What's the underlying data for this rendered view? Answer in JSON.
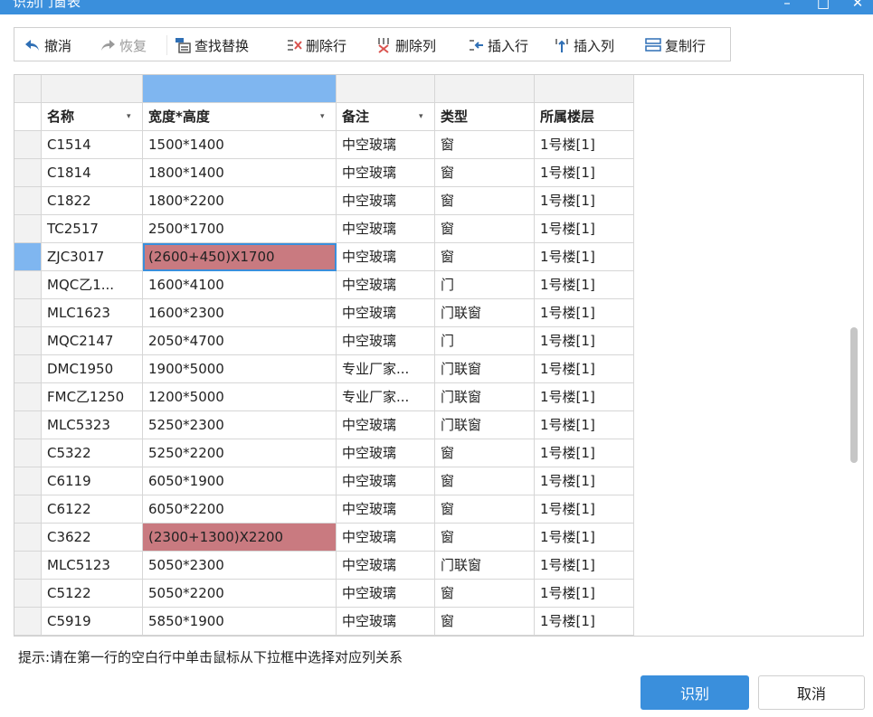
{
  "window": {
    "title": "识别门窗表",
    "min_glyph": "–",
    "max_glyph": "□",
    "close_glyph": "✕"
  },
  "toolbar": {
    "undo": "撤消",
    "redo": "恢复",
    "find_replace": "查找替换",
    "delete_row": "删除行",
    "delete_col": "删除列",
    "insert_row": "插入行",
    "insert_col": "插入列",
    "copy_row": "复制行"
  },
  "table": {
    "headers": [
      "名称",
      "宽度*高度",
      "备注",
      "类型",
      "所属楼层"
    ],
    "rows": [
      [
        "C1514",
        "1500*1400",
        "中空玻璃",
        "窗",
        "1号楼[1]"
      ],
      [
        "C1814",
        "1800*1400",
        "中空玻璃",
        "窗",
        "1号楼[1]"
      ],
      [
        "C1822",
        "1800*2200",
        "中空玻璃",
        "窗",
        "1号楼[1]"
      ],
      [
        "TC2517",
        "2500*1700",
        "中空玻璃",
        "窗",
        "1号楼[1]"
      ],
      [
        "ZJC3017",
        "(2600+450)X1700",
        "中空玻璃",
        "窗",
        "1号楼[1]"
      ],
      [
        "MQC乙1...",
        "1600*4100",
        "中空玻璃",
        "门",
        "1号楼[1]"
      ],
      [
        "MLC1623",
        "1600*2300",
        "中空玻璃",
        "门联窗",
        "1号楼[1]"
      ],
      [
        "MQC2147",
        "2050*4700",
        "中空玻璃",
        "门",
        "1号楼[1]"
      ],
      [
        "DMC1950",
        "1900*5000",
        "专业厂家...",
        "门联窗",
        "1号楼[1]"
      ],
      [
        "FMC乙1250",
        "1200*5000",
        "专业厂家...",
        "门联窗",
        "1号楼[1]"
      ],
      [
        "MLC5323",
        "5250*2300",
        "中空玻璃",
        "门联窗",
        "1号楼[1]"
      ],
      [
        "C5322",
        "5250*2200",
        "中空玻璃",
        "窗",
        "1号楼[1]"
      ],
      [
        "C6119",
        "6050*1900",
        "中空玻璃",
        "窗",
        "1号楼[1]"
      ],
      [
        "C6122",
        "6050*2200",
        "中空玻璃",
        "窗",
        "1号楼[1]"
      ],
      [
        "C3622",
        "(2300+1300)X2200",
        "中空玻璃",
        "窗",
        "1号楼[1]"
      ],
      [
        "MLC5123",
        "5050*2300",
        "中空玻璃",
        "门联窗",
        "1号楼[1]"
      ],
      [
        "C5122",
        "5050*2200",
        "中空玻璃",
        "窗",
        "1号楼[1]"
      ],
      [
        "C5919",
        "5850*1900",
        "中空玻璃",
        "窗",
        "1号楼[1]"
      ]
    ],
    "selected_row": 4,
    "error_cells": [
      [
        4,
        1
      ],
      [
        14,
        1
      ]
    ]
  },
  "hint": "提示:请在第一行的空白行中单击鼠标从下拉框中选择对应列关系",
  "buttons": {
    "ok": "识别",
    "cancel": "取消"
  },
  "colors": {
    "accent": "#3a8fdc",
    "error_cell": "#c97a80",
    "selected_header": "#7fb6f0",
    "selected_rowhead": "#7fb6f0"
  }
}
